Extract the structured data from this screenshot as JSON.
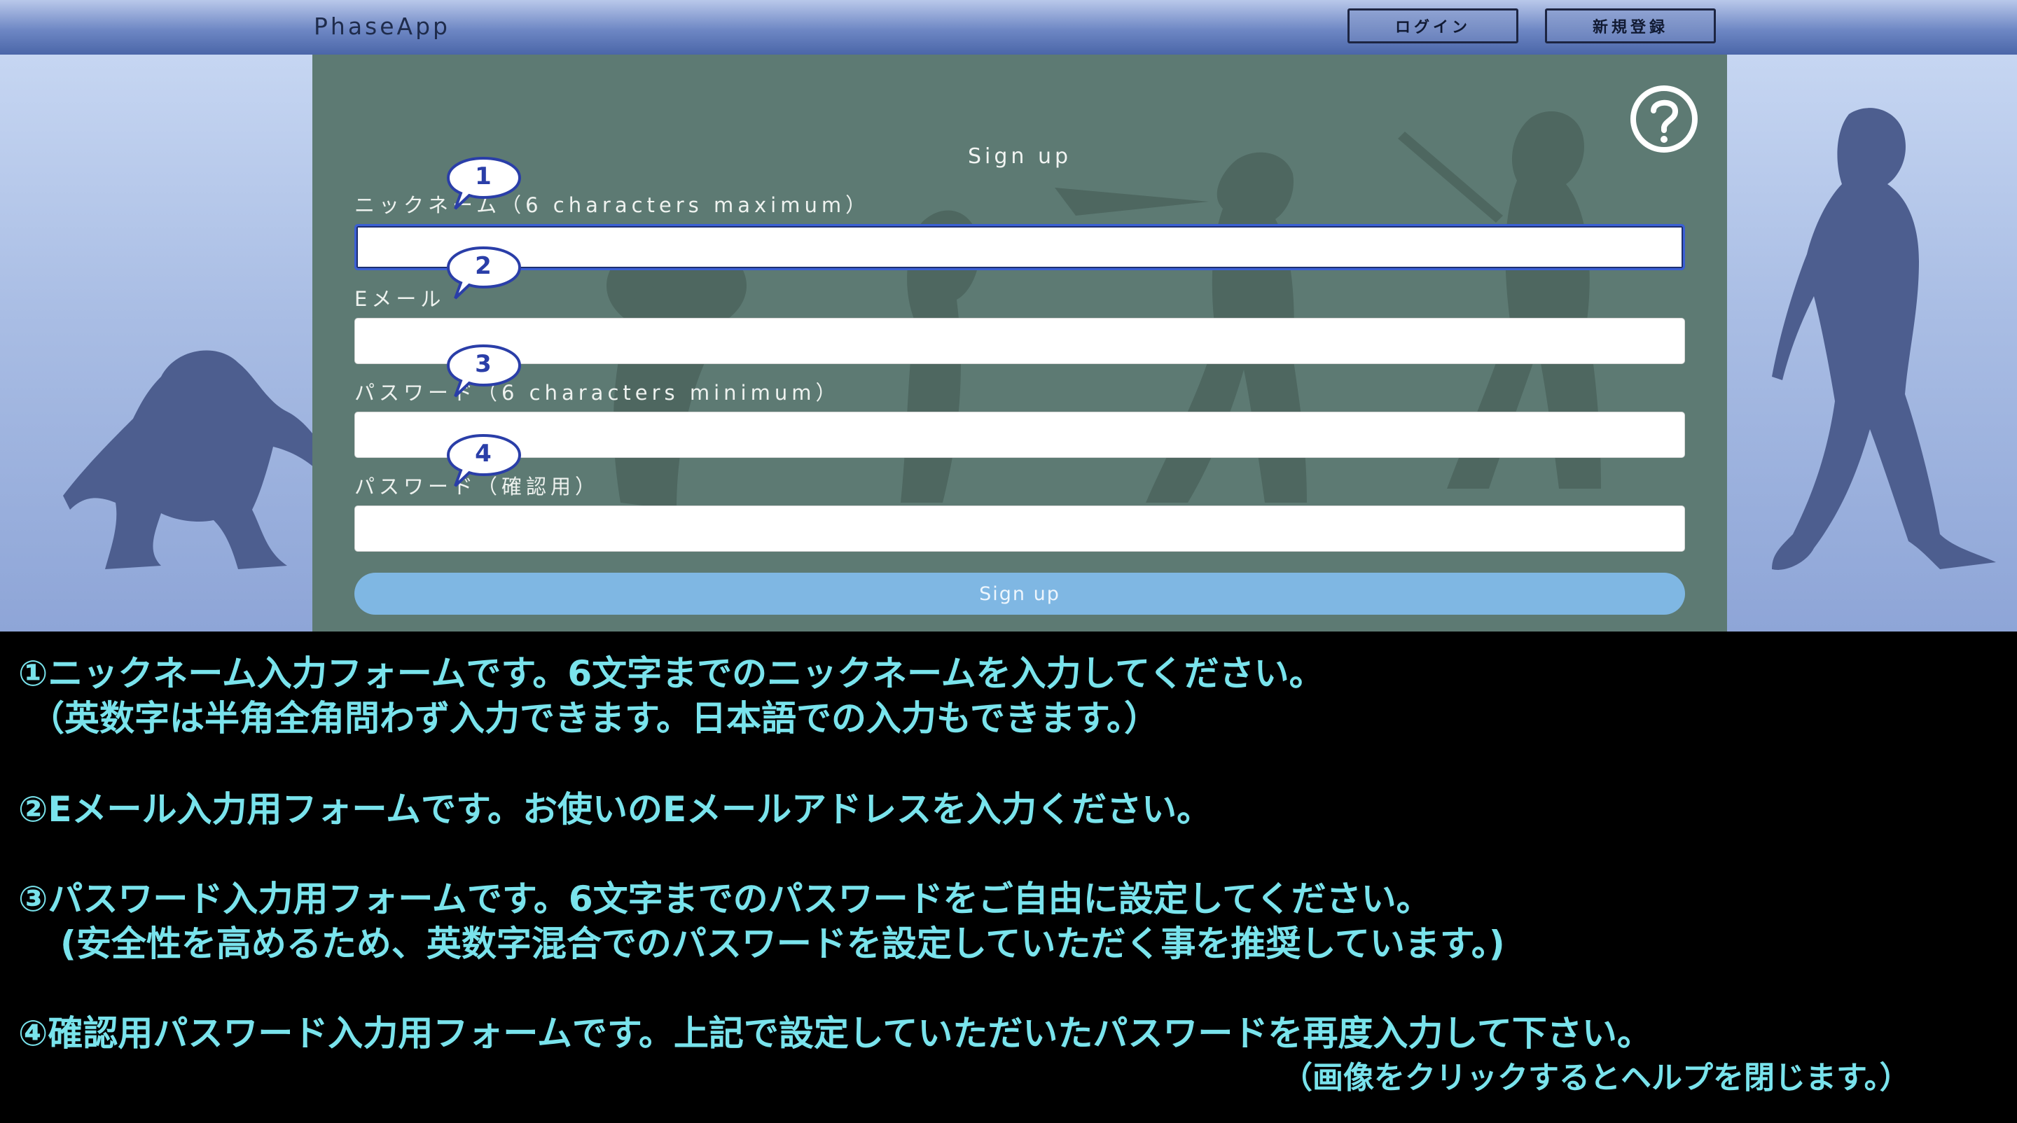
{
  "navbar": {
    "brand": "PhaseApp",
    "login_label": "ログイン",
    "register_label": "新規登録"
  },
  "form": {
    "title": "Sign up",
    "fields": [
      {
        "number": "1",
        "label": "ニックネーム（6 characters maximum）",
        "value": ""
      },
      {
        "number": "2",
        "label": "Eメール",
        "value": ""
      },
      {
        "number": "3",
        "label": "パスワード（6 characters minimum）",
        "value": ""
      },
      {
        "number": "4",
        "label": "パスワード（確認用）",
        "value": ""
      }
    ],
    "submit_label": "Sign up",
    "help_icon": "question-circle-icon"
  },
  "help": {
    "line1": "①ニックネーム入力フォームです。6文字までのニックネームを入力してください。",
    "line1b": "（英数字は半角全角問わず入力できます。日本語での入力もできます。）",
    "line2": "②Eメール入力用フォームです。お使いのEメールアドレスを入力ください。",
    "line3": "③パスワード入力用フォームです。6文字までのパスワードをご自由に設定してください。",
    "line3b": "(安全性を高めるため、英数字混合でのパスワードを設定していただく事を推奨しています。)",
    "line4": "④確認用パスワード入力用フォームです。上記で設定していただいたパスワードを再度入力して下さい。",
    "close_note": "（画像をクリックするとヘルプを閉じます。）"
  },
  "colors": {
    "help_text": "#79e3ec",
    "card": "#5d7a73",
    "submit": "#7fb7e3",
    "navbar": "#6e87c4"
  }
}
